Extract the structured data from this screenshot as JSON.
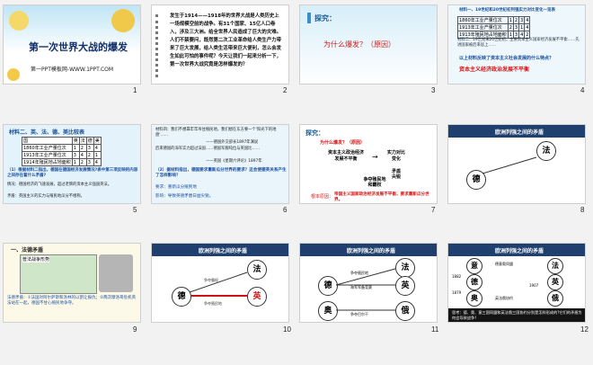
{
  "slides": [
    {
      "num": "1",
      "title": "第一次世界大战的爆发",
      "footer": "第一PPT模板网-WWW.1PPT.COM"
    },
    {
      "num": "2",
      "body": "发生于1914——1918年的世界大战是人类历史上一场规模空前的战争。有31个国家、15亿人口卷入，涉及三大洲。给全世界人民造成了巨大的灾难。人们不禁要问，既然第二次工业革命给人类生产力带来了巨大发展，给人类生活带来巨大便利，怎么会发生如此可怕的事件呢？今天让我们一起来分析一下，第一次世界大战究竟是怎样爆发的？"
    },
    {
      "num": "3",
      "heading": "探究：",
      "question": "为什么爆发？（原因）"
    },
    {
      "num": "4",
      "header": "材料一、19世纪和20世纪初列强实力对比变化一览表",
      "rows": [
        [
          "1860年工业产量位次",
          "1",
          "2",
          "3",
          "4"
        ],
        [
          "1913年工业产量位次",
          "2",
          "3",
          "1",
          "4"
        ],
        [
          "1913年殖民地占地面积",
          "1",
          "3",
          "4",
          "2"
        ]
      ],
      "note": "材料二：19世纪末20世纪初，主要资本主义国家经济发展不平衡……先进国家被后来居上……",
      "q": "以上材料反映了资本主义社会发展的什么特点？",
      "answer": "资本主义经济政治发展不平衡"
    },
    {
      "num": "5",
      "header": "材料二、英、法、德、美比较表",
      "cols": [
        "国",
        "英",
        "法",
        "德",
        "美"
      ],
      "rows": [
        [
          "1860年工业产量位次",
          "1",
          "2",
          "3",
          "4"
        ],
        [
          "1913年工业产量位次",
          "3",
          "4",
          "2",
          "1"
        ],
        [
          "1914年殖民地占地面积",
          "1",
          "2",
          "3",
          "4"
        ]
      ],
      "q1": "（1）根据材料二指出，德国在德国经济发展情况?表中第三项反映的内容之间存在着什么矛盾?",
      "a1": "情况：德国经济的飞速发展，超过老牌的资本主义强国英法。",
      "a2": "矛盾：英国主义的实力与殖民地瓜分不相称。"
    },
    {
      "num": "6",
      "material": "材料四：我们不想靠牢牢吊住殖民地，我们想在东方要一个'阳光下的地盘'……",
      "quote": "——德国外交部长1897年演说",
      "material2": "后来德国的海军实力超过法国……德国军舰吨位与英国比……",
      "quote2": "——英国《星期六评论》1897年",
      "q": "（2）据材料指出，德国要求重新瓜分世界的要求？这会使德英关系产生了怎样影响？",
      "a": "要求：重新瓜分殖民地",
      "effect": "影响：导致英德矛盾日益尖锐。"
    },
    {
      "num": "7",
      "heading": "探究：",
      "q": "为什么爆发？（原因）",
      "left": "资本主义政治经济发展不平衡",
      "right": "实力对比变化",
      "arrow": "矛盾尖锐",
      "bottom": "争夺殖民地和霸权",
      "conclusion": "帝国主义国家政治经济发展不平衡，要求重新瓜分世界。",
      "label": "根本原因："
    },
    {
      "num": "8",
      "title": "欧洲列强之间的矛盾",
      "nodes": [
        "法",
        "德"
      ]
    },
    {
      "num": "9",
      "title": "一、法德矛盾",
      "map_title": "普法战争形势",
      "caption": "法德矛盾：①法国对阿尔萨斯和洛林的以割让报仇；②两次摩洛哥危机英法站在一起，德国不甘心殖民地争夺。"
    },
    {
      "num": "10",
      "title": "欧洲列强之间的矛盾",
      "nodes": [
        "法",
        "德",
        "英"
      ],
      "label1": "争夺霸权",
      "label2": "争夺殖民地"
    },
    {
      "num": "11",
      "title": "欧洲列强之间的矛盾",
      "nodes": [
        "法",
        "德",
        "英",
        "奥",
        "俄"
      ],
      "l1": "海军军备竞赛",
      "l2": "争夺殖民地",
      "l3": "争夺巴尔干"
    },
    {
      "num": "12",
      "title": "欧洲列强之间的矛盾",
      "nodes": [
        "意",
        "德",
        "奥",
        "法",
        "英",
        "俄"
      ],
      "years": [
        "1882",
        "1907",
        "1879"
      ],
      "l1": "德意奥同盟",
      "l2": "英法俄协约",
      "bottom": "思考：德、奥、意三国同盟和英法俄三国协约分别是怎样形成的?它们的矛盾为何会导致战争？"
    }
  ]
}
